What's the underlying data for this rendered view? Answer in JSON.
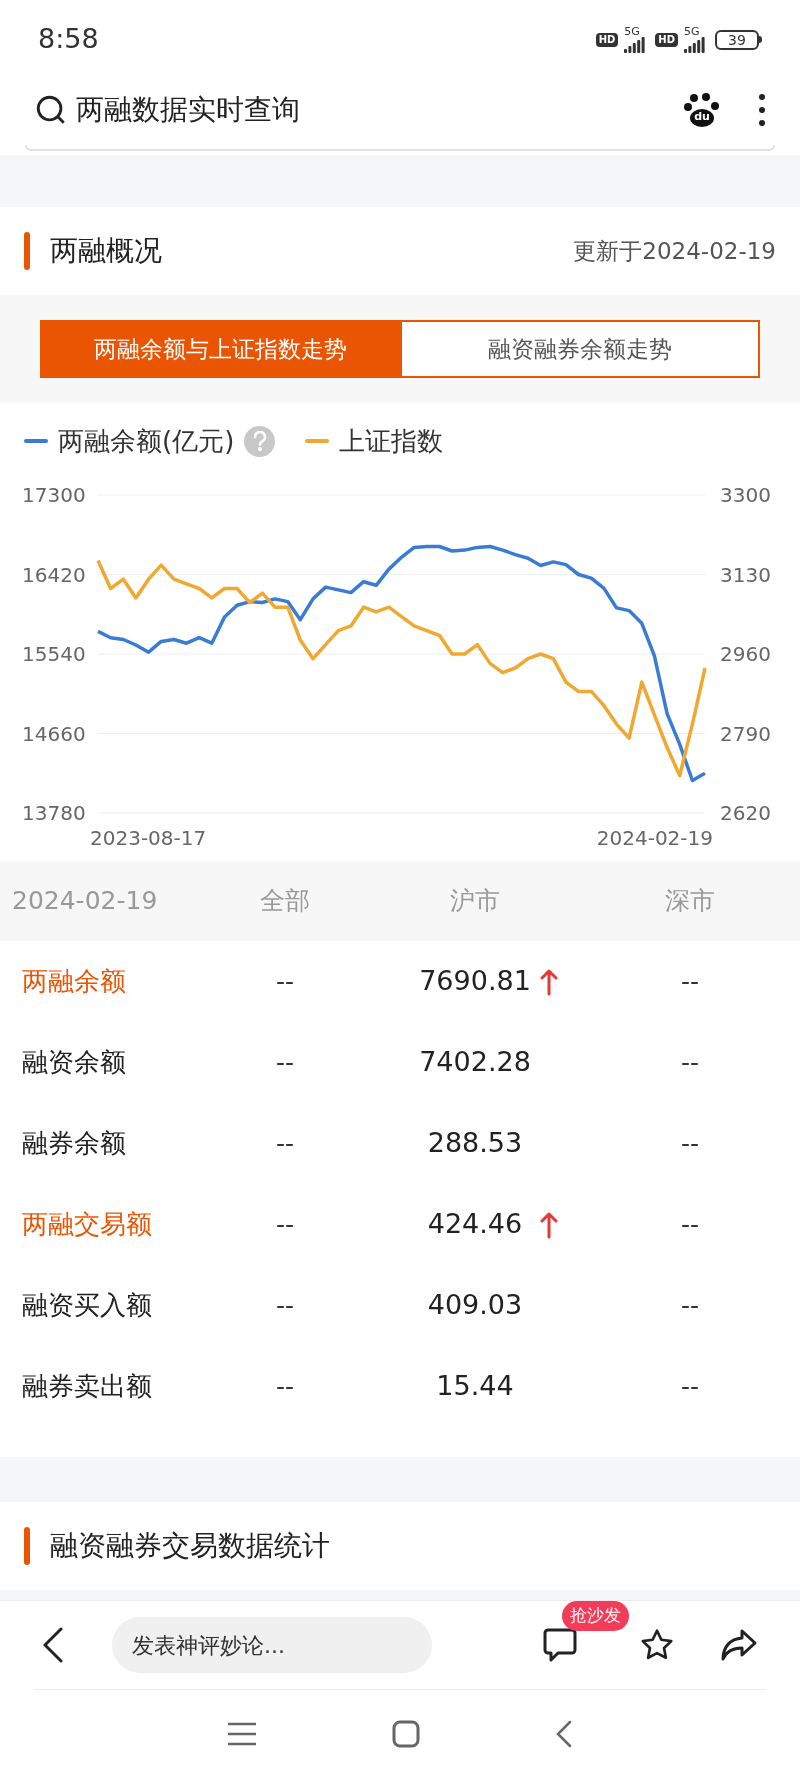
{
  "status_bar": {
    "time": "8:58",
    "sims": [
      {
        "badge": "HD",
        "network": "5G"
      },
      {
        "badge": "HD",
        "network": "5G"
      }
    ],
    "battery": "39"
  },
  "search_bar": {
    "query": "两融数据实时查询",
    "logo_text": "du"
  },
  "overview": {
    "title": "两融概况",
    "updated": "更新于2024-02-19",
    "tabs": [
      {
        "label": "两融余额与上证指数走势",
        "selected": true
      },
      {
        "label": "融资融券余额走势",
        "selected": false
      }
    ],
    "legend_help_icon": true,
    "date_labels": [
      "2023-08-17",
      "2024-02-19"
    ],
    "chart_data": {
      "type": "line",
      "grid": true,
      "ylim": [
        13780,
        17300
      ],
      "yticks": [
        13780,
        14660,
        15540,
        16420,
        17300
      ],
      "y2lim": [
        2620,
        3300
      ],
      "y2ticks": [
        2620,
        2790,
        2960,
        3130,
        3300
      ],
      "series": [
        {
          "name": "两融余额(亿元)",
          "color": "#3a7bd5",
          "values": [
            15790,
            15720,
            15700,
            15640,
            15560,
            15680,
            15700,
            15660,
            15720,
            15660,
            15950,
            16080,
            16120,
            16110,
            16150,
            16120,
            15920,
            16150,
            16280,
            16250,
            16220,
            16340,
            16300,
            16480,
            16610,
            16720,
            16730,
            16730,
            16680,
            16690,
            16720,
            16730,
            16690,
            16640,
            16600,
            16520,
            16560,
            16530,
            16420,
            16380,
            16270,
            16050,
            16020,
            15880,
            15520,
            14880,
            14540,
            14140,
            14220
          ]
        },
        {
          "name": "上证指数",
          "color": "#f0a830",
          "axis": "y2",
          "values": [
            3160,
            3100,
            3120,
            3080,
            3120,
            3150,
            3120,
            3110,
            3100,
            3080,
            3100,
            3100,
            3070,
            3090,
            3060,
            3060,
            2990,
            2950,
            2980,
            3010,
            3020,
            3060,
            3050,
            3060,
            3040,
            3020,
            3010,
            3000,
            2960,
            2960,
            2980,
            2940,
            2920,
            2930,
            2950,
            2960,
            2950,
            2900,
            2880,
            2880,
            2850,
            2810,
            2780,
            2900,
            2830,
            2760,
            2700,
            2810,
            2930
          ]
        }
      ]
    },
    "table": {
      "columns": [
        "2024-02-19",
        "全部",
        "沪市",
        "深市"
      ],
      "rows": [
        {
          "label": "两融余额",
          "highlight": true,
          "all": "--",
          "sh": "7690.81",
          "sz": "--",
          "rising": true
        },
        {
          "label": "融资余额",
          "highlight": false,
          "all": "--",
          "sh": "7402.28",
          "sz": "--",
          "rising": false
        },
        {
          "label": "融券余额",
          "highlight": false,
          "all": "--",
          "sh": "288.53",
          "sz": "--",
          "rising": false
        },
        {
          "label": "两融交易额",
          "highlight": true,
          "all": "--",
          "sh": "424.46",
          "sz": "--",
          "rising": true
        },
        {
          "label": "融资买入额",
          "highlight": false,
          "all": "--",
          "sh": "409.03",
          "sz": "--",
          "rising": false
        },
        {
          "label": "融券卖出额",
          "highlight": false,
          "all": "--",
          "sh": "15.44",
          "sz": "--",
          "rising": false
        }
      ]
    }
  },
  "stats_section": {
    "title": "融资融券交易数据统计"
  },
  "bottom_bar": {
    "comment_placeholder": "发表神评妙论...",
    "badge": "抢沙发"
  }
}
